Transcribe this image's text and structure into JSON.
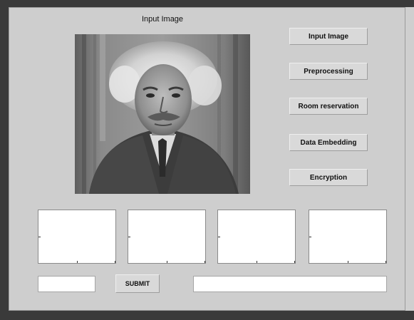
{
  "image_panel": {
    "title": "Input Image"
  },
  "buttons": {
    "input_image": "Input Image",
    "preprocessing": "Preprocessing",
    "room_reservation": "Room reservation",
    "data_embedding": "Data Embedding",
    "encryption": "Encryption",
    "submit": "SUBMIT"
  },
  "fields": {
    "left_value": "",
    "result_value": ""
  },
  "colors": {
    "panel_background": "#cecece",
    "window_frame": "#3a3a3a",
    "button_face": "#d9d9d9"
  }
}
